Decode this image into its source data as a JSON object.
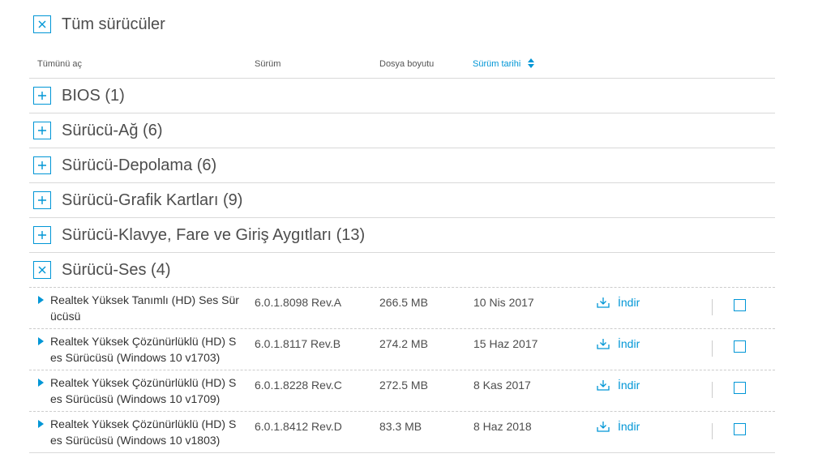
{
  "header": {
    "title": "Tüm sürücüler"
  },
  "columns": {
    "expand_all": "Tümünü aç",
    "version": "Sürüm",
    "file_size": "Dosya boyutu",
    "release_date": "Sürüm tarihi"
  },
  "categories": [
    {
      "label": "BIOS (1)"
    },
    {
      "label": "Sürücü-Ağ (6)"
    },
    {
      "label": "Sürücü-Depolama (6)"
    },
    {
      "label": "Sürücü-Grafik Kartları (9)"
    },
    {
      "label": "Sürücü-Klavye, Fare ve Giriş Aygıtları (13)"
    },
    {
      "label": "Sürücü-Ses (4)"
    }
  ],
  "drivers": [
    {
      "name": "Realtek Yüksek Tanımlı (HD) Ses Sürücüsü",
      "version": "6.0.1.8098 Rev.A",
      "size": "266.5 MB",
      "date": "10 Nis 2017",
      "download": "İndir"
    },
    {
      "name": "Realtek Yüksek Çözünürlüklü (HD) Ses Sürücüsü (Windows 10 v1703)",
      "version": "6.0.1.8117 Rev.B",
      "size": "274.2 MB",
      "date": "15 Haz 2017",
      "download": "İndir"
    },
    {
      "name": "Realtek Yüksek Çözünürlüklü (HD) Ses Sürücüsü (Windows 10 v1709)",
      "version": "6.0.1.8228 Rev.C",
      "size": "272.5 MB",
      "date": "8 Kas 2017",
      "download": "İndir"
    },
    {
      "name": "Realtek Yüksek Çözünürlüklü (HD) Ses Sürücüsü (Windows 10 v1803)",
      "version": "6.0.1.8412 Rev.D",
      "size": "83.3 MB",
      "date": "8 Haz 2018",
      "download": "İndir"
    }
  ],
  "colors": {
    "accent": "#0096d6",
    "text": "#4d4d4d",
    "rule": "#d9d9d9"
  },
  "icons": {
    "collapse": "close-x-icon",
    "expand": "plus-icon",
    "row_toggle": "triangle-right-icon",
    "download": "download-icon",
    "sort": "sort-icon"
  }
}
